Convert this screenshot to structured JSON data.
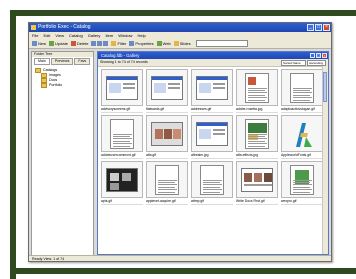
{
  "app": {
    "title": "Portfolio Exec - Catalog",
    "menu": [
      "File",
      "Edit",
      "View",
      "Catalog",
      "Gallery",
      "Item",
      "Window",
      "Help"
    ],
    "toolbar": [
      "New",
      "Update",
      "Delete",
      "Filter",
      "Properties",
      "Web",
      "Slides"
    ]
  },
  "left_panel": {
    "title": "Folder Tree",
    "tabs": [
      "Main",
      "Previews",
      "Favs"
    ],
    "tree": {
      "root": "Catalogs",
      "children": [
        "Images",
        "Docs",
        "Portfolio"
      ]
    },
    "status": "Ready    View: 1 of 74"
  },
  "catalog_window": {
    "title": "Catalog.fdb - Gallery",
    "info": "Showing 1 to 74 of 74 records",
    "sort_value": "Sorted Name",
    "order_value": "Ascending",
    "items": [
      {
        "name": "advisoryscreens.gif",
        "art": "screen"
      },
      {
        "name": "flatwards.gif",
        "art": "screen"
      },
      {
        "name": "addresses.gif",
        "art": "screen"
      },
      {
        "name": "adobe-rosetta.jpg",
        "art": "page-red"
      },
      {
        "name": "adaptoactiovslogan.gif",
        "art": "page"
      },
      {
        "name": "adobeusercommunt.gif",
        "art": "page"
      },
      {
        "name": "alfa.gif",
        "art": "faces"
      },
      {
        "name": "aflrealm.jpg",
        "art": "screen"
      },
      {
        "name": "alfa-effects.jpg",
        "art": "page-color"
      },
      {
        "name": "AppleworldFonts.gif",
        "art": "logo"
      },
      {
        "name": "apts.gif",
        "art": "dark"
      },
      {
        "name": "applevet-acquire.gif",
        "art": "page"
      },
      {
        "name": "attmp.gif",
        "art": "page"
      },
      {
        "name": "Write Docs First.gif",
        "art": "people"
      },
      {
        "name": "wexpro.gif",
        "art": "page-green"
      }
    ]
  }
}
